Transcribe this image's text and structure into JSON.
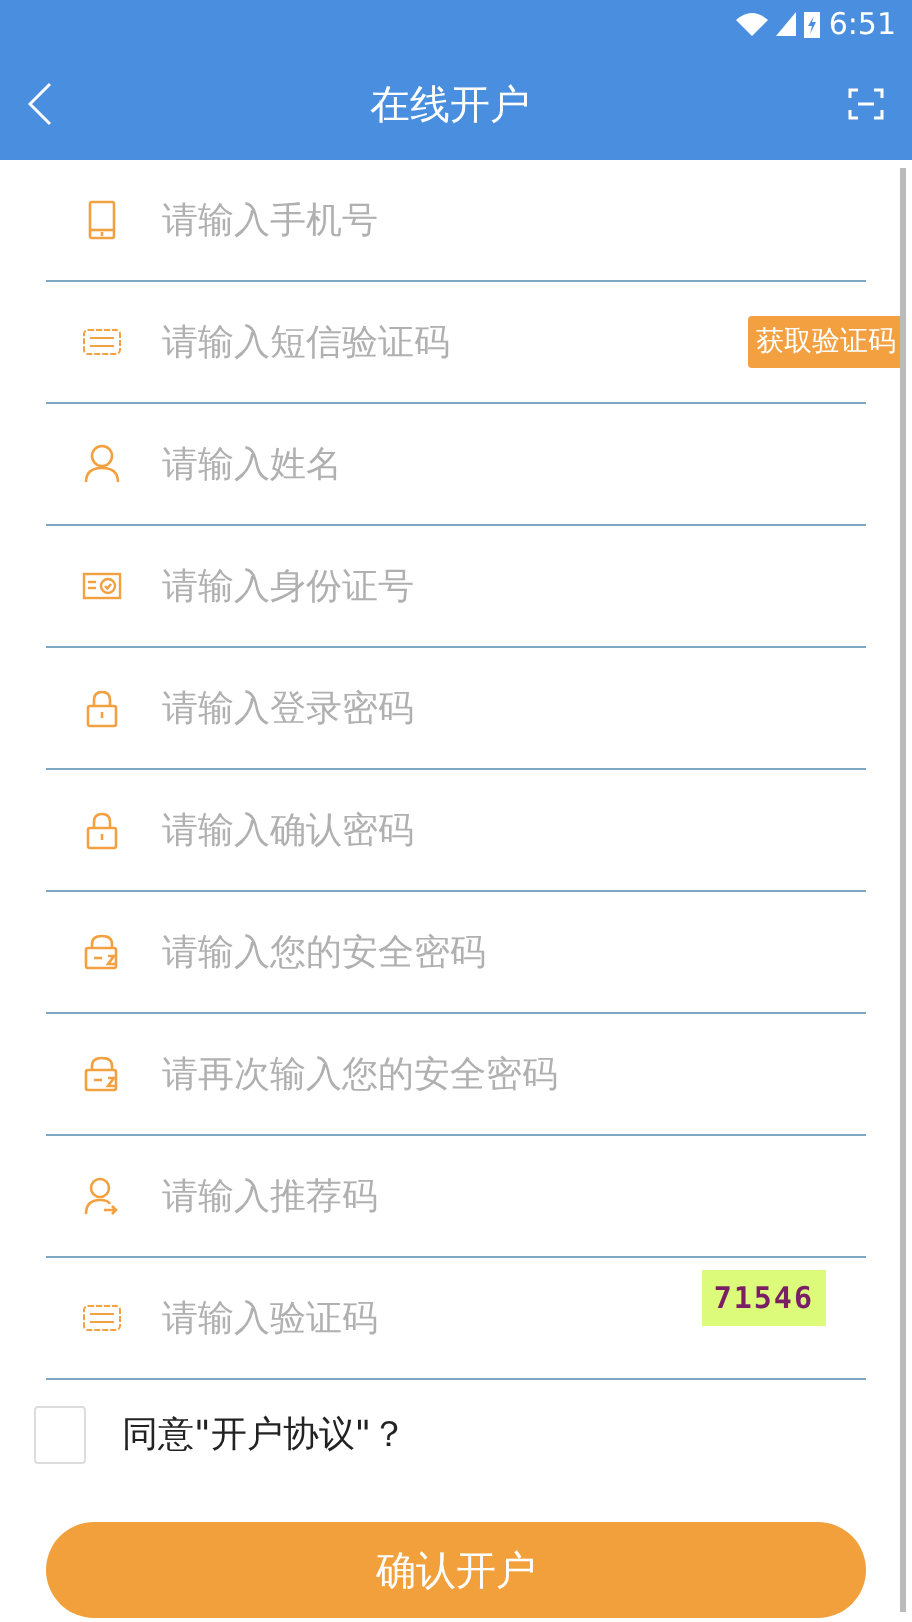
{
  "status_bar": {
    "time": "6:51"
  },
  "header": {
    "title": "在线开户"
  },
  "fields": [
    {
      "kind": "phone",
      "placeholder": "请输入手机号"
    },
    {
      "kind": "sms",
      "placeholder": "请输入短信验证码",
      "action": "获取验证码"
    },
    {
      "kind": "person",
      "placeholder": "请输入姓名"
    },
    {
      "kind": "idcard",
      "placeholder": "请输入身份证号"
    },
    {
      "kind": "lock",
      "placeholder": "请输入登录密码"
    },
    {
      "kind": "lock",
      "placeholder": "请输入确认密码"
    },
    {
      "kind": "safe",
      "placeholder": "请输入您的安全密码"
    },
    {
      "kind": "safe",
      "placeholder": "请再次输入您的安全密码"
    },
    {
      "kind": "referrer",
      "placeholder": "请输入推荐码"
    },
    {
      "kind": "code",
      "placeholder": "请输入验证码",
      "captcha": "71546"
    }
  ],
  "agreement": {
    "label": "同意\"开户协议\"？",
    "checked": false
  },
  "submit": "确认开户"
}
